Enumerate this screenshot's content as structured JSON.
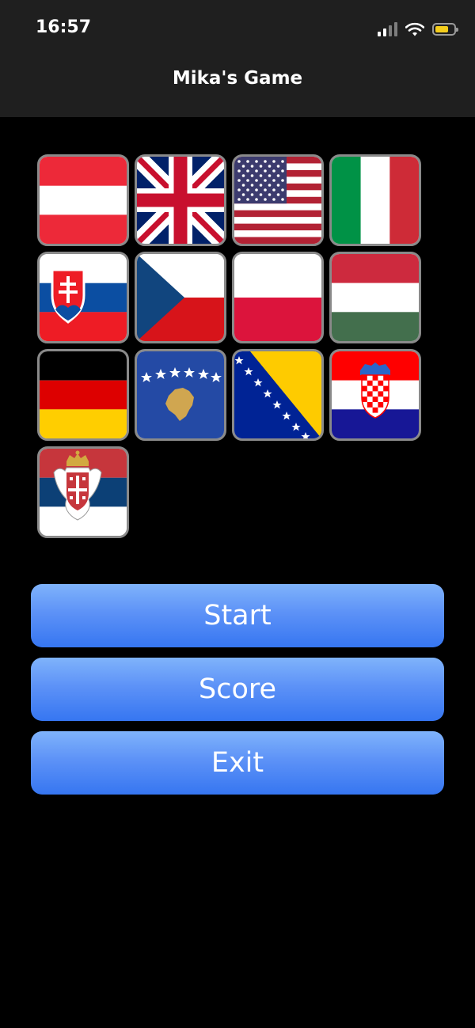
{
  "status_bar": {
    "time": "16:57"
  },
  "header": {
    "title": "Mika's Game"
  },
  "flags": [
    {
      "country": "austria",
      "name": "austria-flag"
    },
    {
      "country": "united-kingdom",
      "name": "united-kingdom-flag"
    },
    {
      "country": "united-states",
      "name": "united-states-flag"
    },
    {
      "country": "italy",
      "name": "italy-flag"
    },
    {
      "country": "slovakia",
      "name": "slovakia-flag"
    },
    {
      "country": "czech-republic",
      "name": "czech-republic-flag"
    },
    {
      "country": "poland",
      "name": "poland-flag"
    },
    {
      "country": "hungary",
      "name": "hungary-flag"
    },
    {
      "country": "germany",
      "name": "germany-flag"
    },
    {
      "country": "kosovo",
      "name": "kosovo-flag"
    },
    {
      "country": "bosnia-and-herzegovina",
      "name": "bosnia-flag"
    },
    {
      "country": "croatia",
      "name": "croatia-flag"
    },
    {
      "country": "serbia",
      "name": "serbia-flag"
    }
  ],
  "menu": {
    "start_label": "Start",
    "score_label": "Score",
    "exit_label": "Exit"
  },
  "colors": {
    "header_bg": "#1f1f1f",
    "background": "#000000",
    "button_top": "#7fb3fb",
    "button_bottom": "#3676f1",
    "battery": "#f4cd1c"
  }
}
